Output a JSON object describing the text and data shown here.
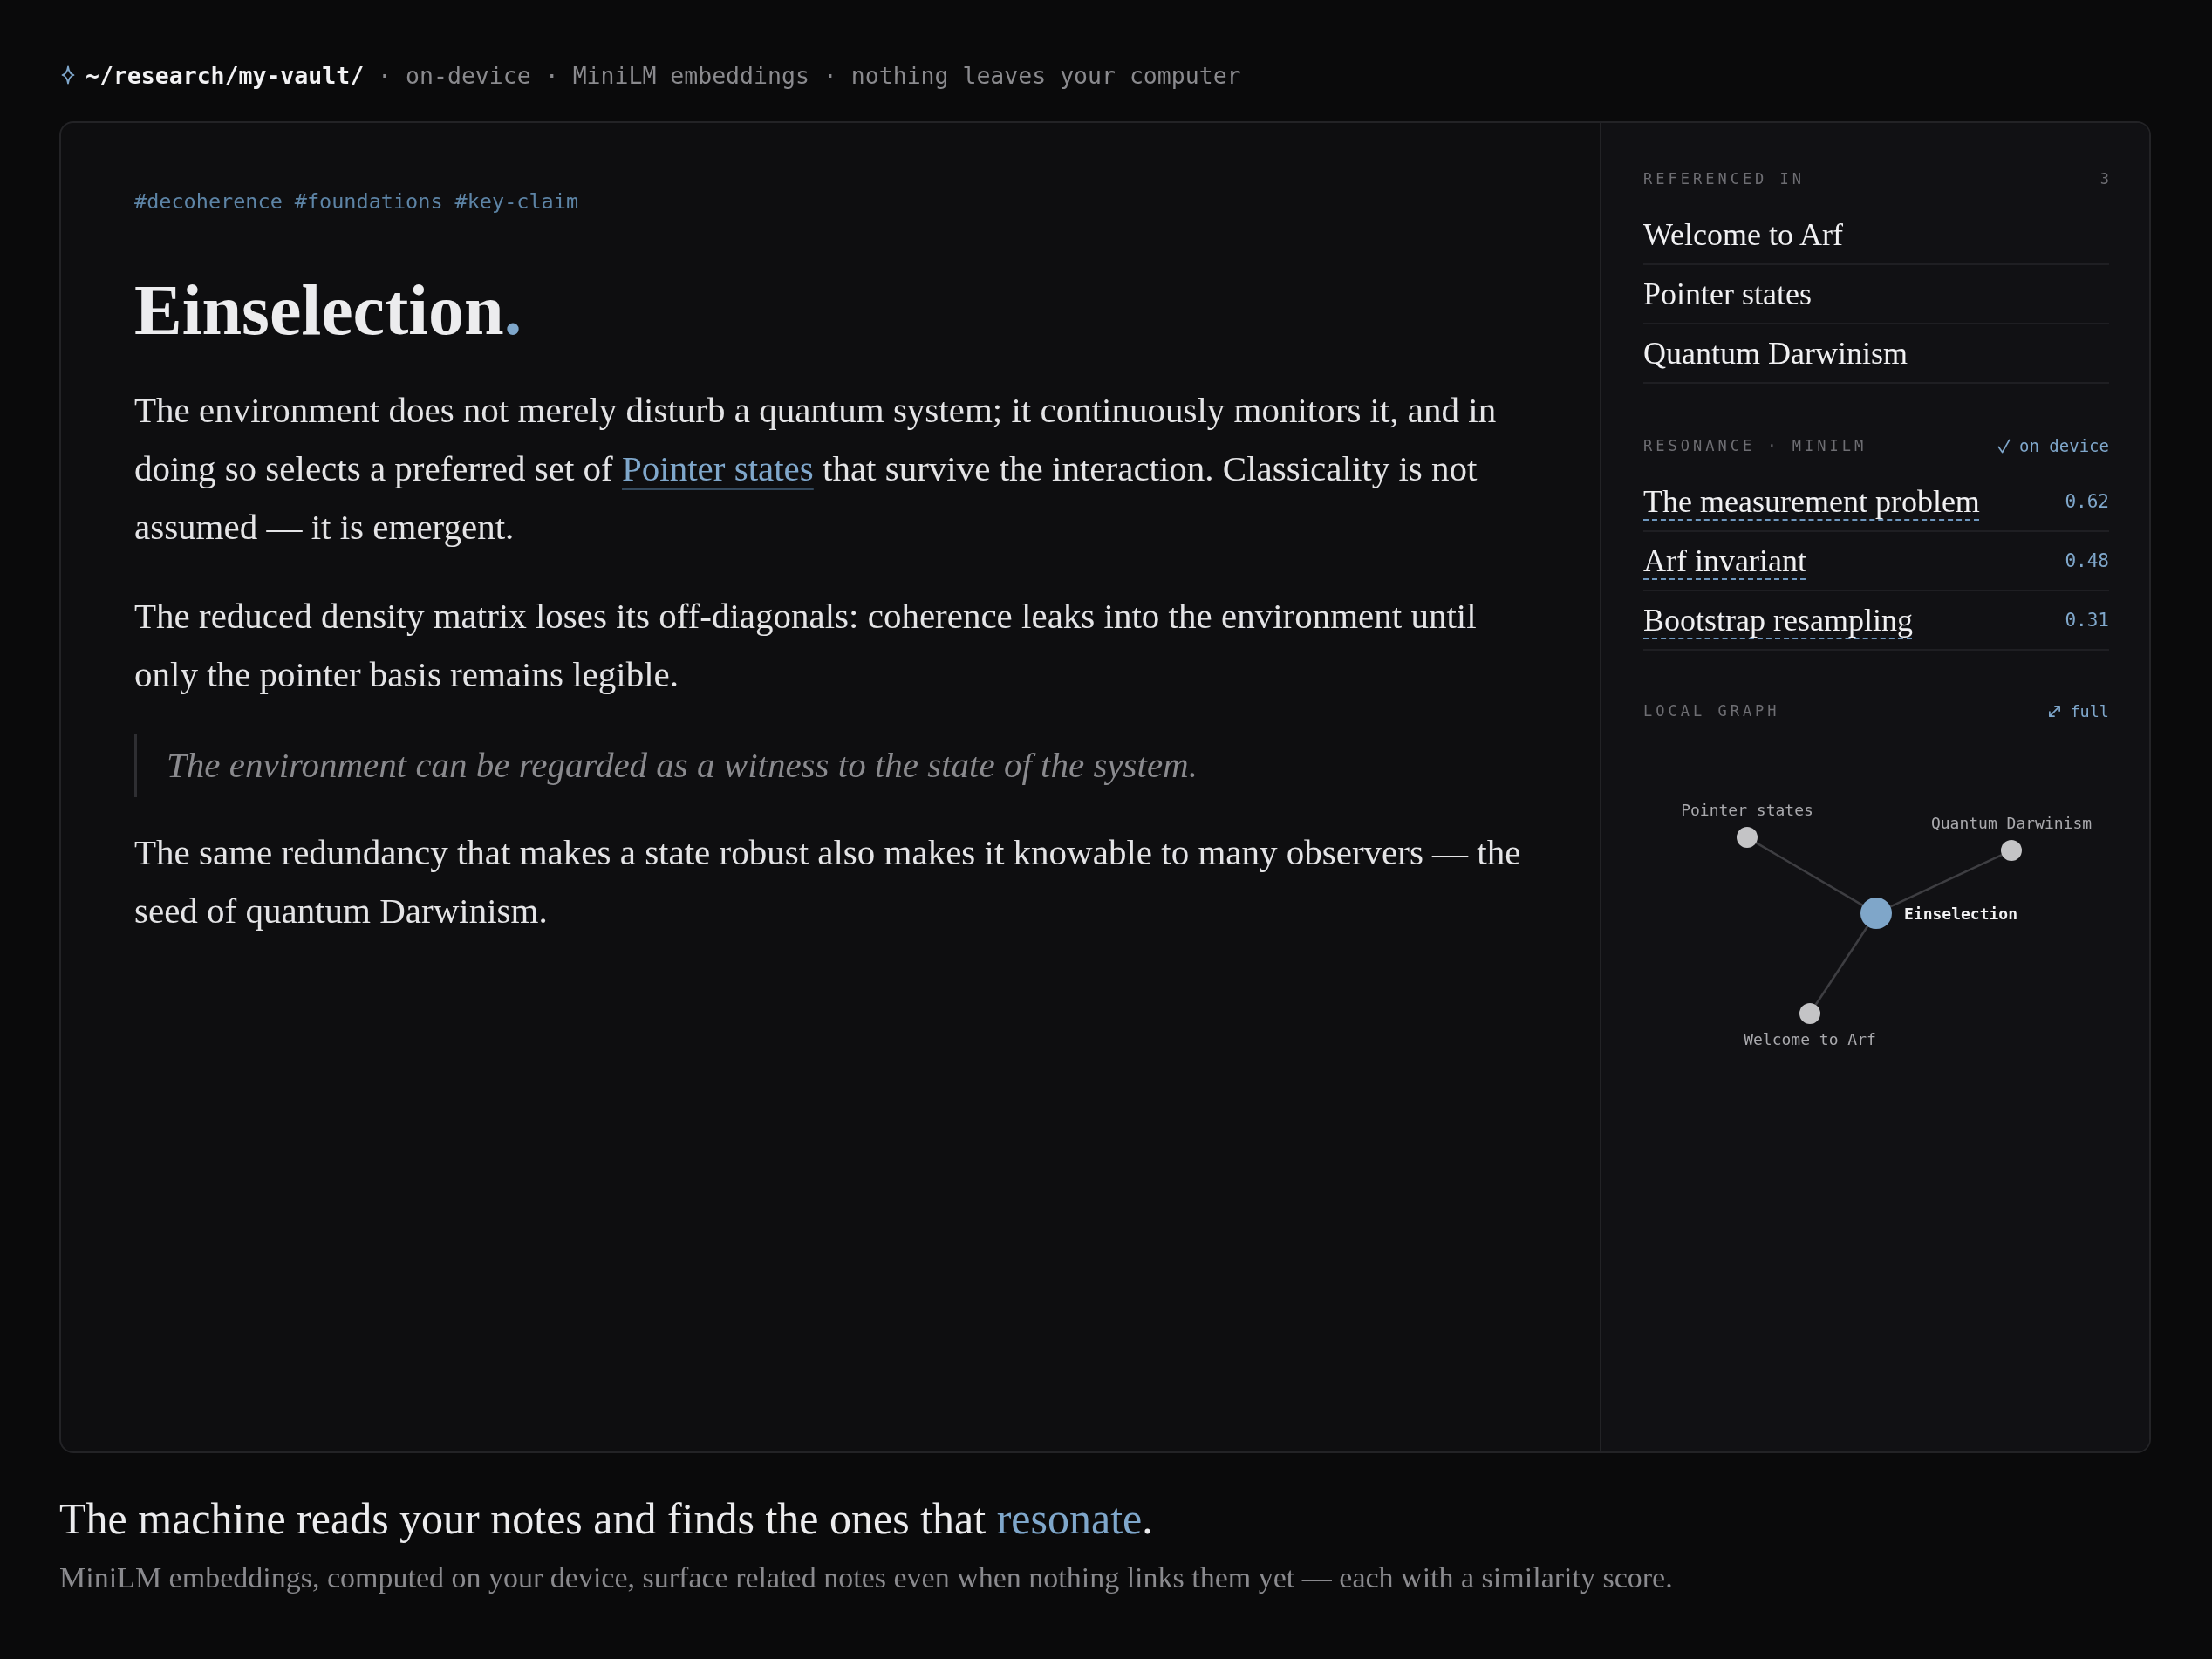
{
  "header": {
    "path": "~/research/my-vault/",
    "meta": [
      {
        "separator": "·",
        "text": "on-device"
      },
      {
        "separator": "·",
        "text": "MiniLM embeddings"
      },
      {
        "separator": "·",
        "text": "nothing leaves your computer"
      }
    ]
  },
  "note": {
    "tags": [
      "#decoherence",
      "#foundations",
      "#key-claim"
    ],
    "title": {
      "text": "Einselection",
      "accent": "."
    },
    "blocks": [
      {
        "kind": "paragraph",
        "segments": [
          {
            "kind": "plain",
            "text": "The environment does not merely disturb a quantum system; it continuously monitors it, and in doing so selects a preferred set of "
          },
          {
            "kind": "link",
            "text": "Pointer states"
          },
          {
            "kind": "plain",
            "text": " that survive the interaction. Classicality is not assumed — it is emergent."
          }
        ]
      },
      {
        "kind": "paragraph",
        "segments": [
          {
            "kind": "plain",
            "text": "The reduced density matrix loses its off-diagonals: coherence leaks into the environment until only the pointer basis remains legible."
          }
        ]
      },
      {
        "kind": "quote",
        "segments": [
          {
            "kind": "plain",
            "text": "The environment can be regarded as a witness to the state of the system."
          }
        ]
      },
      {
        "kind": "paragraph",
        "segments": [
          {
            "kind": "plain",
            "text": "The same redundancy that makes a state robust also makes it knowable to many observers — the seed of quantum Darwinism."
          }
        ]
      }
    ]
  },
  "sidebar": {
    "referenced_in": {
      "title": "REFERENCED IN",
      "count": "3",
      "items": [
        "Welcome to Arf",
        "Pointer states",
        "Quantum Darwinism"
      ]
    },
    "resonance": {
      "title": "RESONANCE · MINILM",
      "badge": "on device",
      "items": [
        {
          "title": "The measurement problem",
          "score": "0.62"
        },
        {
          "title": "Arf invariant",
          "score": "0.48"
        },
        {
          "title": "Bootstrap resampling",
          "score": "0.31"
        }
      ]
    },
    "local_graph": {
      "title": "LOCAL GRAPH",
      "action": "full",
      "nodes": [
        {
          "label": "Pointer states",
          "kind": "linked"
        },
        {
          "label": "Quantum Darwinism",
          "kind": "linked"
        },
        {
          "label": "Einselection",
          "kind": "current"
        },
        {
          "label": "Welcome to Arf",
          "kind": "linked"
        }
      ]
    }
  },
  "caption": {
    "headline": [
      {
        "kind": "plain",
        "text": "The machine reads your notes and finds the ones that "
      },
      {
        "kind": "accent",
        "text": "resonate"
      },
      {
        "kind": "plain",
        "text": "."
      }
    ],
    "subline": "MiniLM embeddings, computed on your device, surface related notes even when nothing links them yet — each with a similarity score."
  }
}
